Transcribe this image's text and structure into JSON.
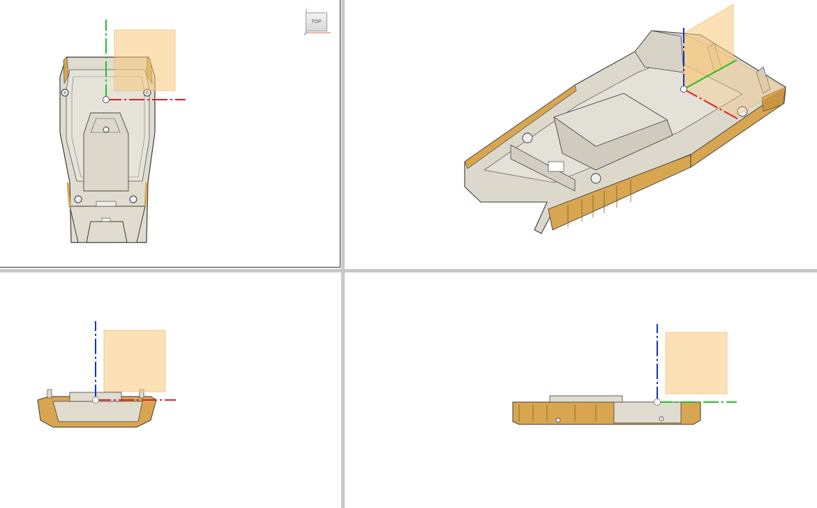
{
  "viewcube": {
    "face_label": "TOP"
  },
  "viewports": [
    "top",
    "isometric",
    "front",
    "right"
  ],
  "colors": {
    "body": "#e2ded4",
    "body_edge": "#3a3a3a",
    "accent_part": "#d8a650",
    "plane": "#f9c97a",
    "axis_x": "#e02020",
    "axis_y": "#20c020",
    "axis_z": "#1030d0",
    "divider": "#c8c8c8"
  }
}
